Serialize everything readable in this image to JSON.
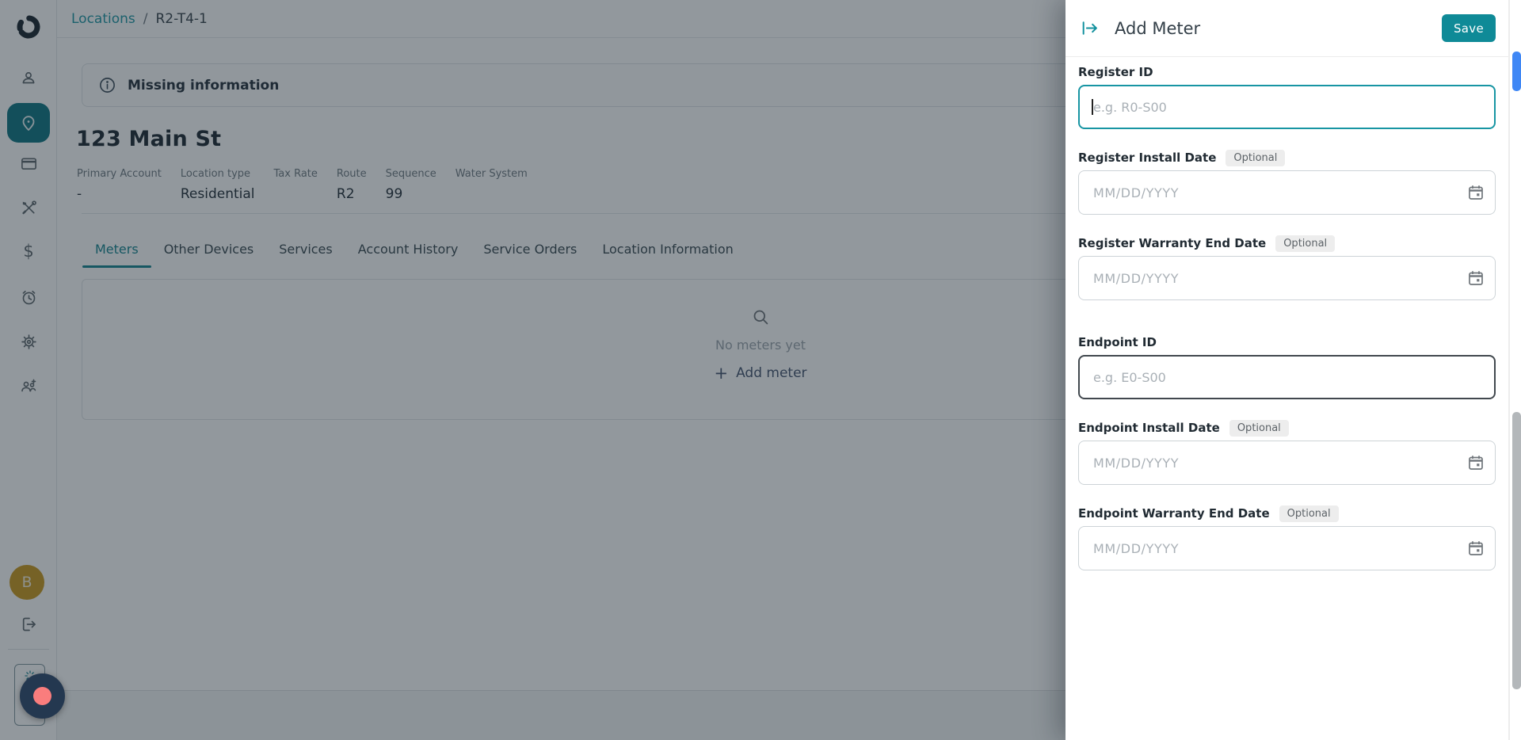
{
  "colors": {
    "primary_teal": "#0F8A97",
    "link_teal": "#1E96A4",
    "accent_navy": "#44536E",
    "avatar_gold": "#C9971C",
    "scroll_thumb_blue": "#3F87F5",
    "launcher_navy": "#243850",
    "launcher_dot": "#FA7D7D"
  },
  "sidebar": {
    "avatar_initial": "B"
  },
  "breadcrumb": {
    "parent": "Locations",
    "separator": "/",
    "current": "R2-T4-1"
  },
  "banner": {
    "message": "Missing information"
  },
  "location": {
    "title": "123 Main St",
    "details": [
      {
        "label": "Primary Account",
        "value": "-"
      },
      {
        "label": "Location type",
        "value": "Residential"
      },
      {
        "label": "Tax Rate",
        "value": ""
      },
      {
        "label": "Route",
        "value": "R2"
      },
      {
        "label": "Sequence",
        "value": "99"
      },
      {
        "label": "Water System",
        "value": ""
      }
    ]
  },
  "tabs": {
    "items": [
      {
        "label": "Meters"
      },
      {
        "label": "Other Devices"
      },
      {
        "label": "Services"
      },
      {
        "label": "Account History"
      },
      {
        "label": "Service Orders"
      },
      {
        "label": "Location Information"
      }
    ]
  },
  "meters": {
    "empty_text": "No meters yet",
    "add_button": "Add meter"
  },
  "drawer": {
    "title": "Add Meter",
    "save_button": "Save",
    "optional_badge": "Optional",
    "fields": [
      {
        "label": "Register ID",
        "placeholder": "e.g. R0-S00"
      },
      {
        "label": "Register Install Date",
        "placeholder": "MM/DD/YYYY"
      },
      {
        "label": "Register Warranty End Date",
        "placeholder": "MM/DD/YYYY"
      },
      {
        "label": "Endpoint ID",
        "placeholder": "e.g. E0-S00"
      },
      {
        "label": "Endpoint Install Date",
        "placeholder": "MM/DD/YYYY"
      },
      {
        "label": "Endpoint Warranty End Date",
        "placeholder": "MM/DD/YYYY"
      }
    ]
  }
}
